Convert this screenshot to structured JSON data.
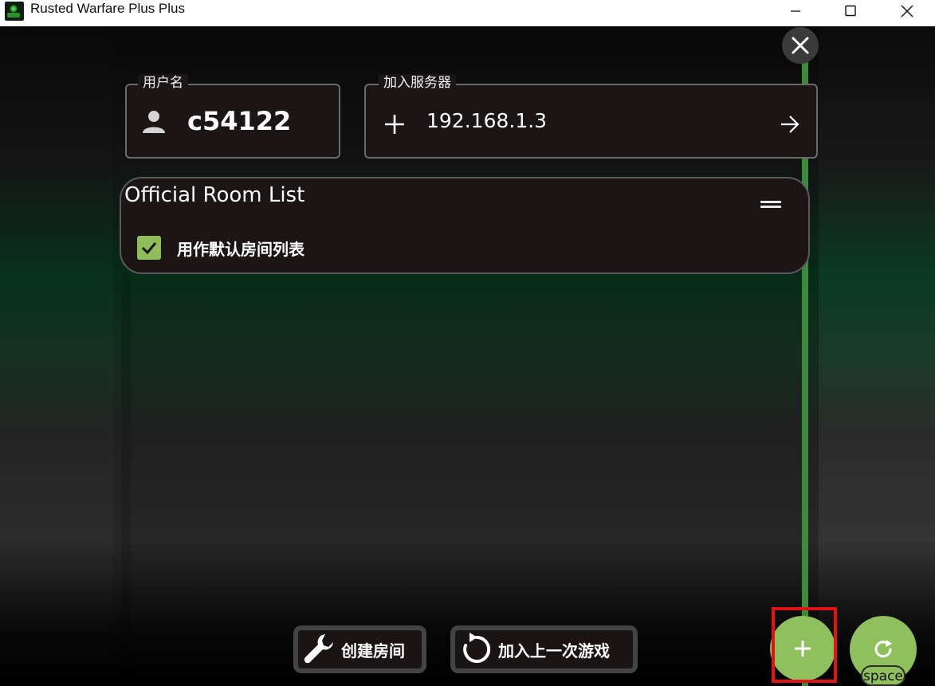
{
  "window": {
    "title": "Rusted Warfare Plus Plus",
    "icons": {
      "app": "app-icon",
      "minimize": "minimize-icon",
      "maximize": "maximize-icon",
      "close": "close-icon"
    }
  },
  "form": {
    "username": {
      "legend": "用户名",
      "value": "c54122",
      "icon": "user-icon"
    },
    "server": {
      "legend": "加入服务器",
      "value": "192.168.1.3",
      "left_icon": "plus-icon",
      "right_icon": "arrow-right-icon"
    }
  },
  "room_list": {
    "title": "Official Room List",
    "default_checkbox": {
      "label": "用作默认房间列表",
      "checked": true
    }
  },
  "actions": {
    "create_room": "创建房间",
    "rejoin_last": "加入上一次游戏"
  },
  "fab": {
    "add_icon": "plus-icon",
    "refresh_icon": "refresh-icon",
    "refresh_hint": "space"
  },
  "colors": {
    "accent": "#90bf5e",
    "green_line": "#3c8a3a",
    "field_bg": "#1b1515",
    "highlight": "#e01414"
  }
}
